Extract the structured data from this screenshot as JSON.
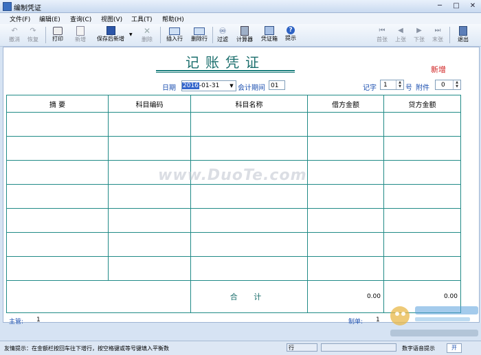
{
  "window": {
    "title": "编制凭证",
    "minimize": "─",
    "maximize": "□",
    "close": "✕"
  },
  "menu": [
    "文件(F)",
    "编辑(E)",
    "查询(C)",
    "视图(V)",
    "工具(T)",
    "帮助(H)"
  ],
  "toolbar": {
    "undo": "撤消",
    "redo": "恢复",
    "print": "打印",
    "new": "新增",
    "save_new": "保存后新增",
    "delete": "删除",
    "insert_row": "插入行",
    "delete_row": "删除行",
    "filter": "过滤",
    "calculator": "计算器",
    "voucher_box": "凭证箱",
    "hint": "提示",
    "first": "首张",
    "prev": "上张",
    "next": "下张",
    "last": "末张",
    "exit": "退出"
  },
  "icons": {
    "undo": "undo-icon",
    "redo": "redo-icon",
    "print": "printer-icon",
    "new": "new-document-icon",
    "save": "save-icon",
    "delete": "delete-x-icon",
    "insert_row": "insert-row-icon",
    "delete_row": "delete-row-icon",
    "filter": "binoculars-icon",
    "calculator": "calculator-icon",
    "voucher_box": "voucher-box-icon",
    "hint": "help-icon",
    "first": "first-page-icon",
    "prev": "prev-page-icon",
    "next": "next-page-icon",
    "last": "last-page-icon",
    "exit": "exit-door-icon"
  },
  "voucher": {
    "title": "记账凭证",
    "status": "新增",
    "date_label": "日期",
    "date_selected": "2016",
    "date_rest": "-01-31",
    "period_label": "会计期间",
    "period_value": "01",
    "voucher_word_label": "记字",
    "voucher_no": "1",
    "voucher_no_suffix": "号",
    "attachment_label": "附件",
    "attachment_count": "0"
  },
  "table": {
    "headers": [
      "摘    要",
      "科目编码",
      "科目名称",
      "借方金额",
      "贷方金额"
    ],
    "row_count": 7,
    "total_label": "合 计",
    "total_debit": "0.00",
    "total_credit": "0.00"
  },
  "signatures": {
    "supervisor_label": "主管:",
    "supervisor_value": "1",
    "preparer_label": "制单:",
    "preparer_value": "1"
  },
  "watermark": "www.DuoTe.com",
  "statusbar": {
    "message": "友情提示：在金额栏按回车往下增行，按空格键或等号键填入平衡数",
    "row_label": "行",
    "speech_label": "数字语音提示",
    "speech_toggle": "开"
  },
  "colors": {
    "accent": "#1a7d7b",
    "label_blue": "#1b4fb0",
    "status_red": "#d02020"
  }
}
